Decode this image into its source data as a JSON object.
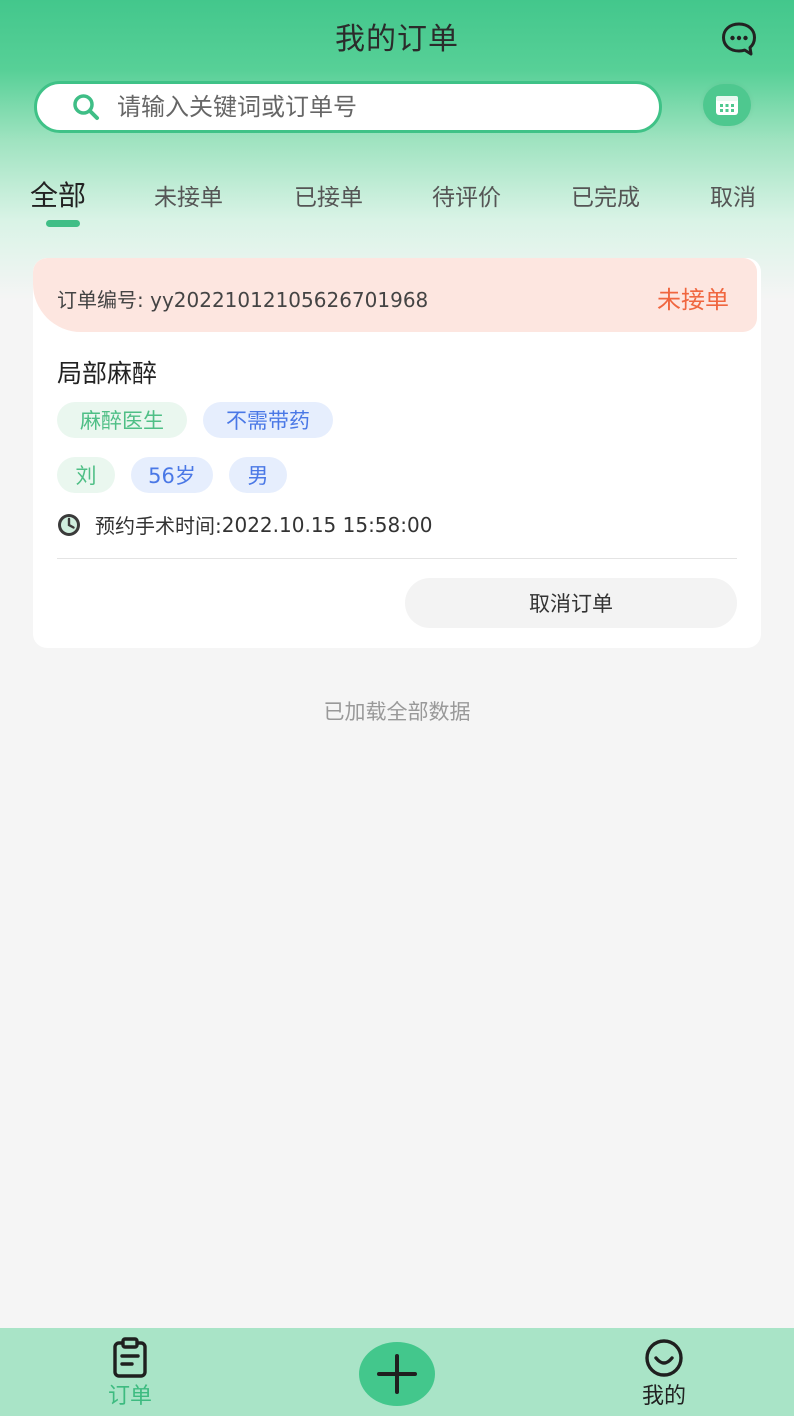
{
  "header": {
    "title": "我的订单"
  },
  "search": {
    "placeholder": "请输入关键词或订单号",
    "value": ""
  },
  "tabs": [
    {
      "label": "全部",
      "active": true
    },
    {
      "label": "未接单",
      "active": false
    },
    {
      "label": "已接单",
      "active": false
    },
    {
      "label": "待评价",
      "active": false
    },
    {
      "label": "已完成",
      "active": false
    },
    {
      "label": "取消",
      "active": false
    }
  ],
  "orders": [
    {
      "order_no_label": "订单编号:",
      "order_no": "yy20221012105626701968",
      "status": "未接单",
      "service": "局部麻醉",
      "tags": [
        "麻醉医生",
        "不需带药"
      ],
      "patient": {
        "name": "刘",
        "age": "56岁",
        "gender": "男"
      },
      "time_label": "预约手术时间:",
      "time": "2022.10.15 15:58:00",
      "cancel_label": "取消订单"
    }
  ],
  "list_footer": "已加载全部数据",
  "bottom_nav": {
    "orders_label": "订单",
    "mine_label": "我的"
  },
  "icons": {
    "message": "message-bubble-icon",
    "search": "search-icon",
    "calendar": "calendar-icon",
    "clock": "clock-icon",
    "orders": "clipboard-icon",
    "add": "plus-icon",
    "mine": "smile-icon"
  },
  "colors": {
    "primary": "#43c78c",
    "status_pending": "#f0663f",
    "tag_green_text": "#4fbf86",
    "tag_blue_text": "#4a78e6"
  }
}
